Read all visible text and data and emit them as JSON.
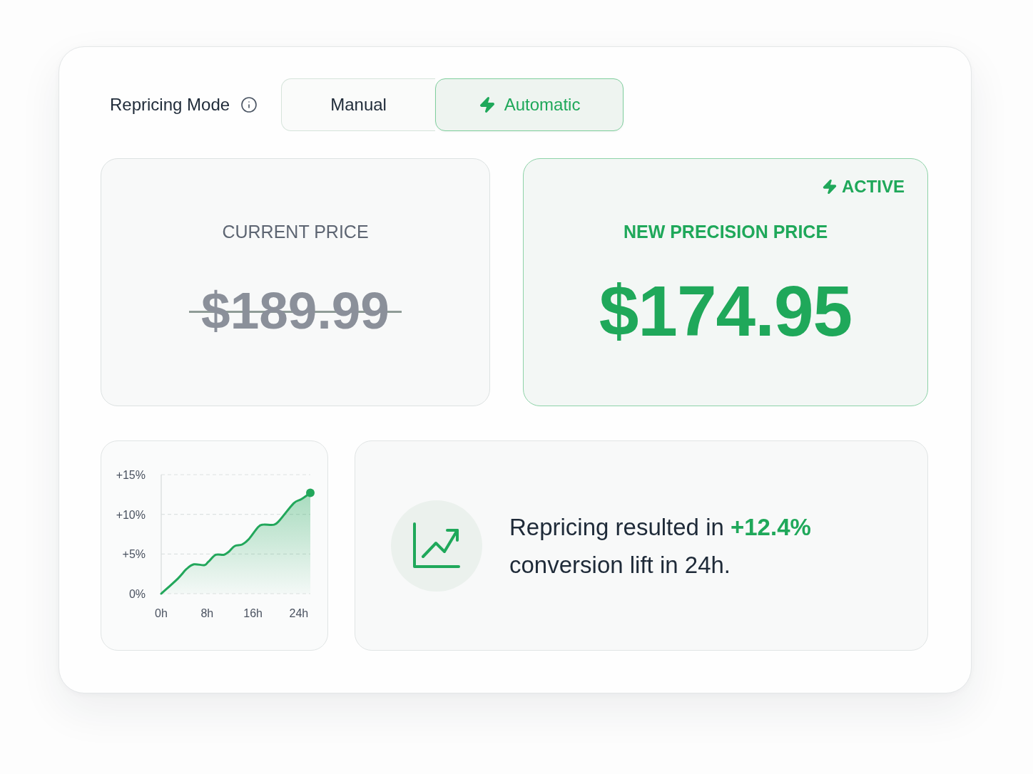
{
  "mode": {
    "label": "Repricing Mode",
    "options": [
      {
        "label": "Manual",
        "kind": "manual",
        "selected": false
      },
      {
        "label": "Automatic",
        "kind": "automatic",
        "selected": true
      }
    ]
  },
  "current_price": {
    "label": "CURRENT PRICE",
    "value": "$189.99",
    "struck": true
  },
  "new_price": {
    "badge": "ACTIVE",
    "label": "NEW PRECISION PRICE",
    "value": "$174.95"
  },
  "trend_chart": {
    "chart_data": {
      "type": "area",
      "xlim": [
        0,
        26
      ],
      "ylim": [
        0,
        15
      ],
      "xticks": [
        {
          "value": 0,
          "label": "0h"
        },
        {
          "value": 8,
          "label": "8h"
        },
        {
          "value": 16,
          "label": "16h"
        },
        {
          "value": 24,
          "label": "24h"
        }
      ],
      "yticks": [
        {
          "value": 0,
          "label": "0%"
        },
        {
          "value": 5,
          "label": "+5%"
        },
        {
          "value": 10,
          "label": "+10%"
        },
        {
          "value": 15,
          "label": "+15%"
        }
      ],
      "x": [
        0,
        2.9,
        4.4,
        5.7,
        7.5,
        8.2,
        9.5,
        10.9,
        11.8,
        12.8,
        14.1,
        15.3,
        16.9,
        17.8,
        19.7,
        20.7,
        23.1,
        24.4,
        26
      ],
      "series": [
        {
          "color": "#22a75b",
          "values": [
            0,
            1.9,
            3.1,
            3.7,
            3.6,
            4.0,
            4.9,
            4.9,
            5.3,
            6.0,
            6.2,
            6.9,
            8.4,
            8.7,
            8.7,
            9.3,
            11.4,
            11.9,
            12.7
          ]
        }
      ]
    }
  },
  "result": {
    "text": "Repricing resulted in **+12.4%** conversion lift in 24h."
  }
}
